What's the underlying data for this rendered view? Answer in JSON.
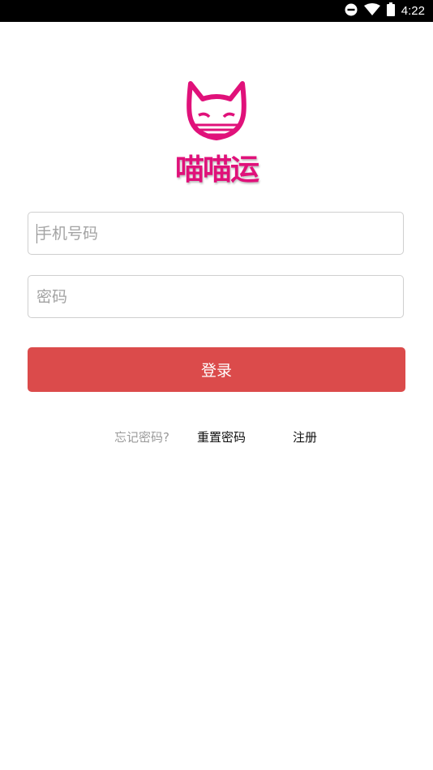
{
  "status_bar": {
    "time": "4:22",
    "icons": [
      "do-not-disturb-icon",
      "wifi-icon",
      "battery-icon"
    ]
  },
  "logo": {
    "text": "喵喵运",
    "icon": "cat-head-icon",
    "color": "#e0117a"
  },
  "form": {
    "phone_placeholder": "手机号码",
    "phone_value": "",
    "password_placeholder": "密码",
    "password_value": "",
    "login_label": "登录",
    "login_color": "#db4b4b"
  },
  "links": {
    "forgot_label": "忘记密码?",
    "reset_label": "重置密码",
    "register_label": "注册"
  }
}
